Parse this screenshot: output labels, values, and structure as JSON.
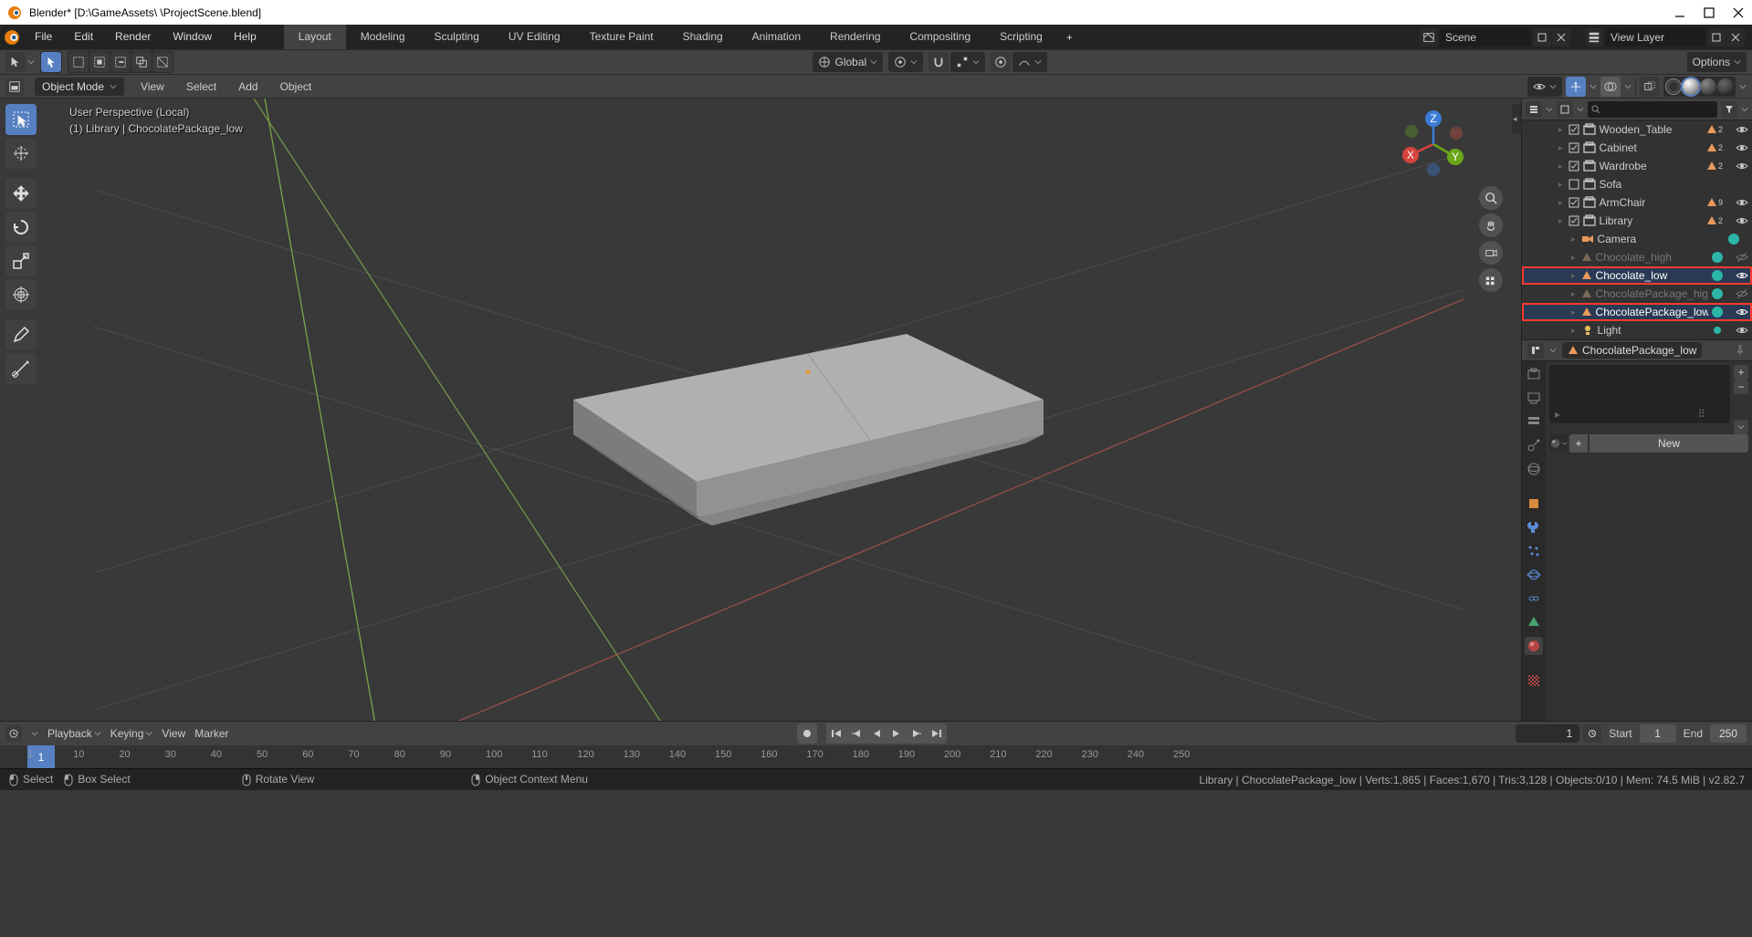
{
  "title": "Blender* [D:\\GameAssets\\                     \\ProjectScene.blend]",
  "menus": [
    "File",
    "Edit",
    "Render",
    "Window",
    "Help"
  ],
  "workspaces": [
    "Layout",
    "Modeling",
    "Sculpting",
    "UV Editing",
    "Texture Paint",
    "Shading",
    "Animation",
    "Rendering",
    "Compositing",
    "Scripting"
  ],
  "active_workspace": "Layout",
  "scene_name": "Scene",
  "viewlayer_name": "View Layer",
  "viewport_header": {
    "orientation": "Global",
    "options": "Options"
  },
  "mode": "Object Mode",
  "sub_menus": [
    "View",
    "Select",
    "Add",
    "Object"
  ],
  "viewport_info": {
    "line1": "User Perspective (Local)",
    "line2": "(1) Library | ChocolatePackage_low"
  },
  "outliner": [
    {
      "type": "collection",
      "name": "Wooden_Table",
      "indent": 32,
      "checked": true,
      "count": 2,
      "vis": true
    },
    {
      "type": "collection",
      "name": "Cabinet",
      "indent": 32,
      "checked": true,
      "count": 2,
      "vis": true
    },
    {
      "type": "collection",
      "name": "Wardrobe",
      "indent": 32,
      "checked": true,
      "count": 2,
      "vis": true
    },
    {
      "type": "collection",
      "name": "Sofa",
      "indent": 32,
      "checked": false,
      "count": null,
      "vis": null
    },
    {
      "type": "collection",
      "name": "ArmChair",
      "indent": 32,
      "checked": true,
      "count": 9,
      "vis": true
    },
    {
      "type": "collection",
      "name": "Library",
      "indent": 32,
      "checked": true,
      "count": 2,
      "vis": true
    },
    {
      "type": "camera",
      "name": "Camera",
      "indent": 46,
      "vis": null,
      "mat": true
    },
    {
      "type": "mesh",
      "name": "Chocolate_high",
      "indent": 46,
      "disabled": true,
      "vis": false,
      "mat": true
    },
    {
      "type": "mesh",
      "name": "Chocolate_low",
      "indent": 46,
      "highlight": true,
      "vis": true,
      "mat": true
    },
    {
      "type": "mesh",
      "name": "ChocolatePackage_high",
      "indent": 46,
      "disabled": true,
      "vis": false,
      "mat": true
    },
    {
      "type": "mesh",
      "name": "ChocolatePackage_low",
      "indent": 46,
      "highlight": true,
      "vis": true,
      "mat": true,
      "active": true
    },
    {
      "type": "light",
      "name": "Light",
      "indent": 46,
      "vis": true,
      "lmat": true
    }
  ],
  "props_context": "ChocolatePackage_low",
  "mat_new": "New",
  "timeline": {
    "menus": [
      "Playback",
      "Keying",
      "View",
      "Marker"
    ],
    "current": 1,
    "start_label": "Start",
    "start": 1,
    "end_label": "End",
    "end": 250,
    "ticks": [
      1,
      10,
      20,
      30,
      40,
      50,
      60,
      70,
      80,
      90,
      100,
      110,
      120,
      130,
      140,
      150,
      160,
      170,
      180,
      190,
      200,
      210,
      220,
      230,
      240,
      250
    ]
  },
  "statusbar": {
    "left": [
      {
        "icon": "mouse-left",
        "label": "Select"
      },
      {
        "icon": "mouse-left",
        "label": "Box Select"
      },
      {
        "icon": "mouse-mid",
        "label": "Rotate View"
      },
      {
        "icon": "mouse-right",
        "label": "Object Context Menu"
      }
    ],
    "right": "Library | ChocolatePackage_low | Verts:1,865 | Faces:1,670 | Tris:3,128 | Objects:0/10 | Mem: 74.5 MiB | v2.82.7"
  },
  "gizmo_axes": {
    "x": "X",
    "y": "Y",
    "z": "Z"
  }
}
